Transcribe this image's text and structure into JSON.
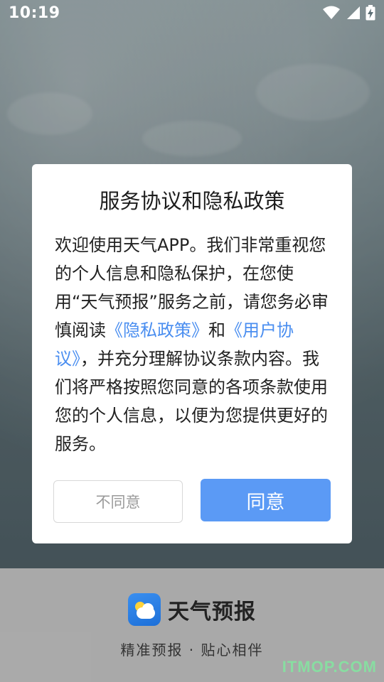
{
  "status_bar": {
    "time": "10:19",
    "icons": [
      "wifi-icon",
      "cellular-signal-icon",
      "battery-charging-icon"
    ]
  },
  "dialog": {
    "title": "服务协议和隐私政策",
    "body": {
      "text_1": "欢迎使用天气APP。我们非常重视您的个人信息和隐私保护，在您使用“天气预报”服务之前，请您务必审慎阅读",
      "privacy_link": "《隐私政策》",
      "text_2": "和",
      "user_agreement_link": "《用户协议》",
      "text_3": "，并充分理解协议条款内容。我们将严格按照您同意的各项条款使用您的个人信息，以便为您提供更好的服务。"
    },
    "disagree_label": "不同意",
    "agree_label": "同意"
  },
  "brand": {
    "name": "天气预报",
    "slogan": "精准预报 · 贴心相伴",
    "logo_icon": "weather-app-logo-icon"
  },
  "watermark": "ITMOP.COM",
  "colors": {
    "accent": "#5b9af5",
    "link": "#4a8ef0",
    "dialog_bg": "#ffffff"
  }
}
